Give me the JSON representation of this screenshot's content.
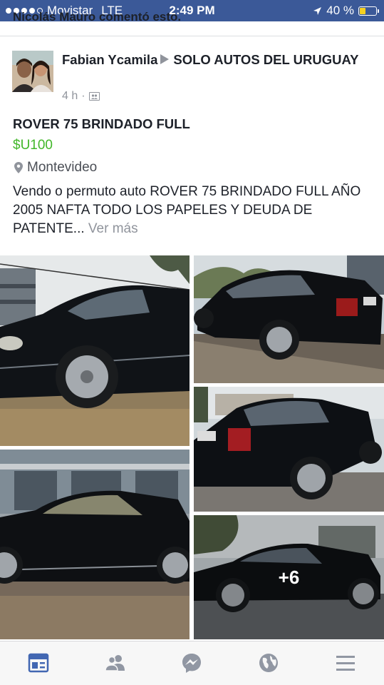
{
  "status_bar": {
    "carrier": "Movistar",
    "network": "LTE",
    "time": "2:49 PM",
    "battery_percent": "40 %",
    "battery_level": 0.4,
    "signal_bars": 4
  },
  "previous_line": {
    "text": "Nicolás Mauro comentó esto."
  },
  "post": {
    "author": "Fabian Ycamila",
    "group": "SOLO AUTOS DEL URUGUAY",
    "time_ago": "4 h",
    "separator": "·",
    "title": "ROVER 75 BRINDADO  FULL",
    "price": "$U100",
    "location": "Montevideo",
    "description": "Vendo o permuto auto  ROVER  75 BRINDADO  FULL AÑO 2005 NAFTA  TODO LOS PAPELES  Y DEUDA DE PATENTE...",
    "see_more": "Ver más",
    "extra_photos": "+6"
  },
  "tabbar": {
    "items": [
      "news-feed-icon",
      "friends-icon",
      "messenger-icon",
      "globe-icon",
      "menu-icon"
    ],
    "active_color": "#4267b2",
    "inactive_color": "#9197a3"
  },
  "colors": {
    "status_bar": "#3b5998",
    "price": "#42b72a",
    "secondary_text": "#90949c"
  }
}
